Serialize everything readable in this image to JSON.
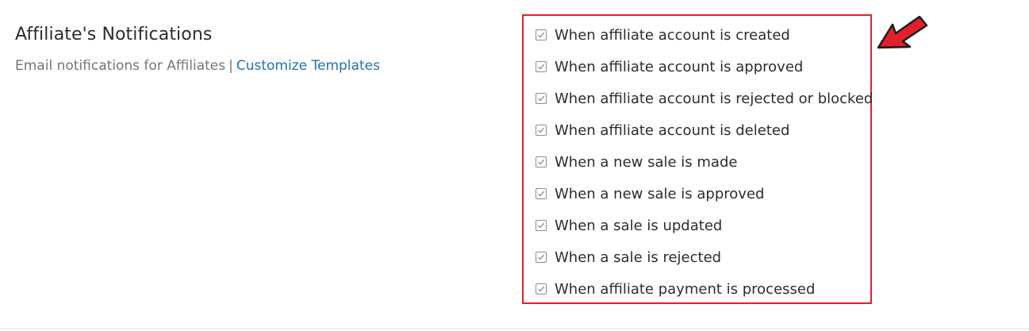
{
  "section": {
    "title": "Affiliate's Notifications",
    "description": "Email notifications for Affiliates",
    "separator": "|",
    "link_label": "Customize Templates"
  },
  "options": [
    {
      "label": "When affiliate account is created",
      "checked": true
    },
    {
      "label": "When affiliate account is approved",
      "checked": true
    },
    {
      "label": "When affiliate account is rejected or blocked",
      "checked": true
    },
    {
      "label": "When affiliate account is deleted",
      "checked": true
    },
    {
      "label": "When a new sale is made",
      "checked": true
    },
    {
      "label": "When a new sale is approved",
      "checked": true
    },
    {
      "label": "When a sale is updated",
      "checked": true
    },
    {
      "label": "When a sale is rejected",
      "checked": true
    },
    {
      "label": "When affiliate payment is processed",
      "checked": true
    }
  ],
  "colors": {
    "highlight_border": "#e0202a",
    "link": "#2271b1",
    "arrow": "#e0202a"
  },
  "icons": {
    "arrow": "red-arrow-icon",
    "check": "checkmark-icon"
  }
}
